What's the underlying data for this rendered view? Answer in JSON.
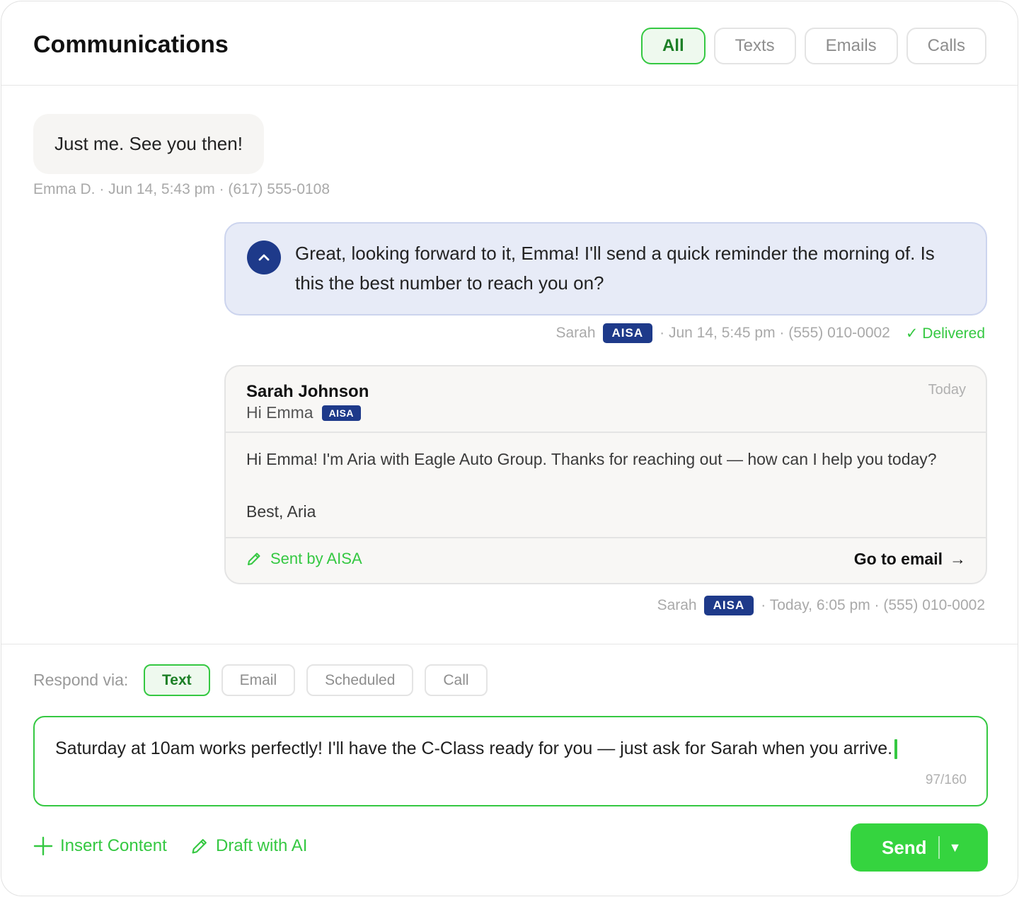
{
  "header": {
    "title": "Communications",
    "filters": [
      {
        "label": "All",
        "active": true
      },
      {
        "label": "Texts",
        "active": false
      },
      {
        "label": "Emails",
        "active": false
      },
      {
        "label": "Calls",
        "active": false
      }
    ]
  },
  "thread": {
    "incoming": {
      "text": "Just me. See you then!",
      "meta": "Emma D. · Jun 14, 5:43 pm · (617) 555-0108"
    },
    "outgoing": {
      "text": "Great, looking forward to it, Emma! I'll send a quick reminder the morning of. Is this the best number to reach you on?",
      "sender": "Sarah",
      "badge": "AISA",
      "meta": "· Jun 14, 5:45 pm · (555) 010-0002",
      "status": "✓ Delivered",
      "avatar_icon": "chevron-up-icon"
    },
    "email": {
      "sender": "Sarah Johnson",
      "subject": "Hi Emma",
      "badge": "AISA",
      "date": "Today",
      "body_line1": "Hi Emma! I'm Aria with Eagle Auto Group. Thanks for reaching out — how can I help you today?",
      "body_line2": "Best, Aria",
      "sent_by": "Sent by AISA",
      "goto": "Go to email",
      "goto_arrow": "→",
      "meta_sender": "Sarah",
      "meta_badge": "AISA",
      "meta": "· Today, 6:05 pm · (555) 010-0002"
    }
  },
  "composer": {
    "respond_label": "Respond via:",
    "channels": [
      {
        "label": "Text",
        "active": true
      },
      {
        "label": "Email",
        "active": false
      },
      {
        "label": "Scheduled",
        "active": false
      },
      {
        "label": "Call",
        "active": false
      }
    ],
    "draft": "Saturday at 10am works perfectly! I'll have the C-Class ready for you — just ask for Sarah when you arrive.",
    "char_count": "97/160",
    "insert_content": "Insert Content",
    "draft_ai": "Draft with AI",
    "send": "Send",
    "send_caret": "▼"
  },
  "colors": {
    "accent_green": "#35c842",
    "badge_navy": "#1e3a8a",
    "outgoing_bubble": "#e7ebf7"
  }
}
